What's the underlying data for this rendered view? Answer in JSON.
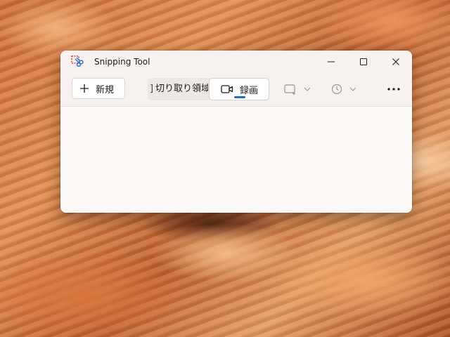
{
  "window": {
    "title": "Snipping Tool",
    "controls": {
      "minimize": "minimize",
      "maximize": "maximize",
      "close": "close"
    }
  },
  "toolbar": {
    "new_label": "新規",
    "snip_mode_label": "切り取り領域",
    "record_label": "録画",
    "selected_mode": "record",
    "snip_shape_icon": "rectangle-snip-icon",
    "delay_icon": "clock-icon",
    "more_icon": "more-horizontal-icon"
  },
  "colors": {
    "accent": "#1f6fc0",
    "window_bg": "#fcf8f6",
    "titlebar_bg": "#f7f1ef"
  }
}
